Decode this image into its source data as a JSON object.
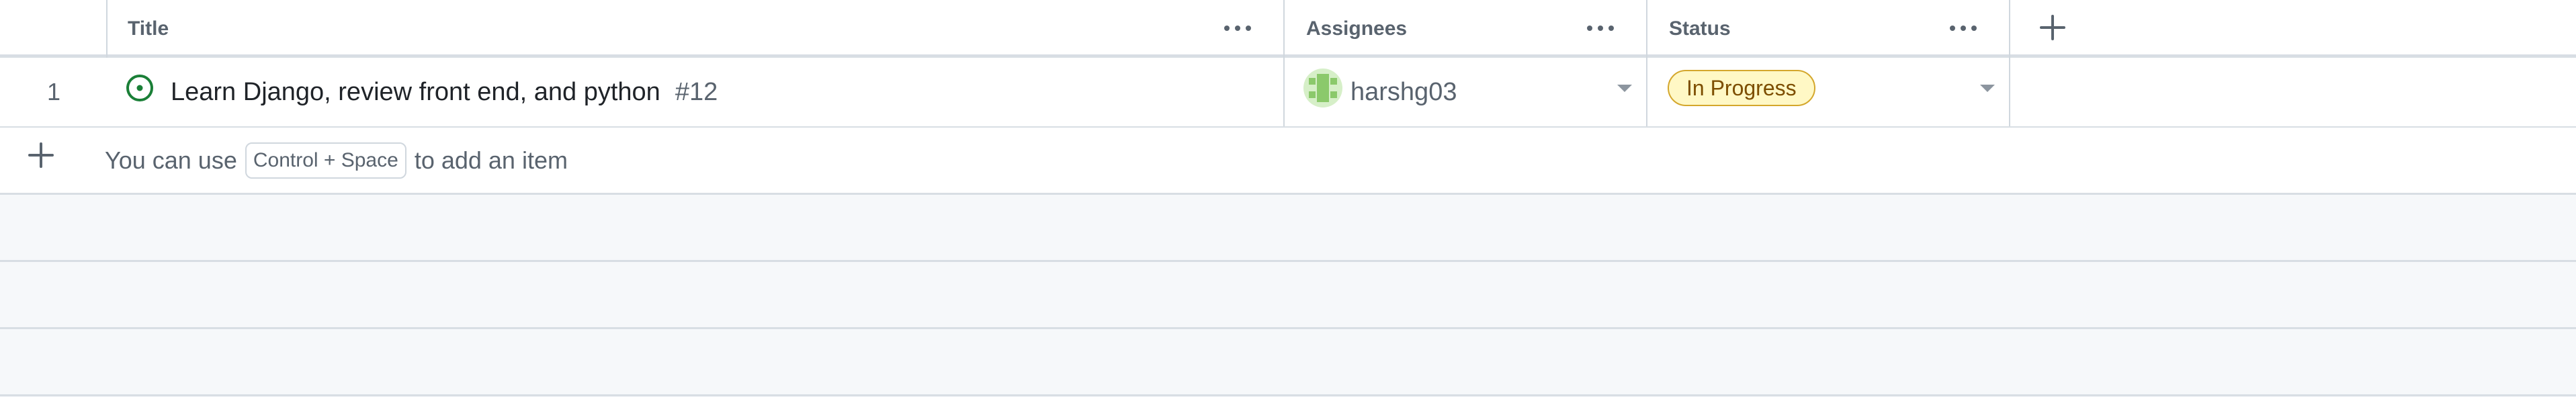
{
  "columns": {
    "title": "Title",
    "assignees": "Assignees",
    "status": "Status"
  },
  "icons": {
    "column_menu": "kebab-horizontal-icon",
    "add_column": "plus-icon",
    "issue_open": "issue-opened-icon",
    "dropdown": "triangle-down-icon",
    "add_item": "plus-icon"
  },
  "rows": [
    {
      "number": "1",
      "title": "Learn Django, review front end, and python",
      "issue_number": "#12",
      "assignee": "harshg03",
      "status": "In Progress"
    }
  ],
  "add_item": {
    "hint_prefix": "You can use",
    "shortcut": "Control + Space",
    "hint_suffix": "to add an item"
  },
  "colors": {
    "status_bg": "#fff8c5",
    "status_border": "#d4a72c",
    "status_text": "#7d4e00",
    "issue_open": "#1a7f37"
  }
}
